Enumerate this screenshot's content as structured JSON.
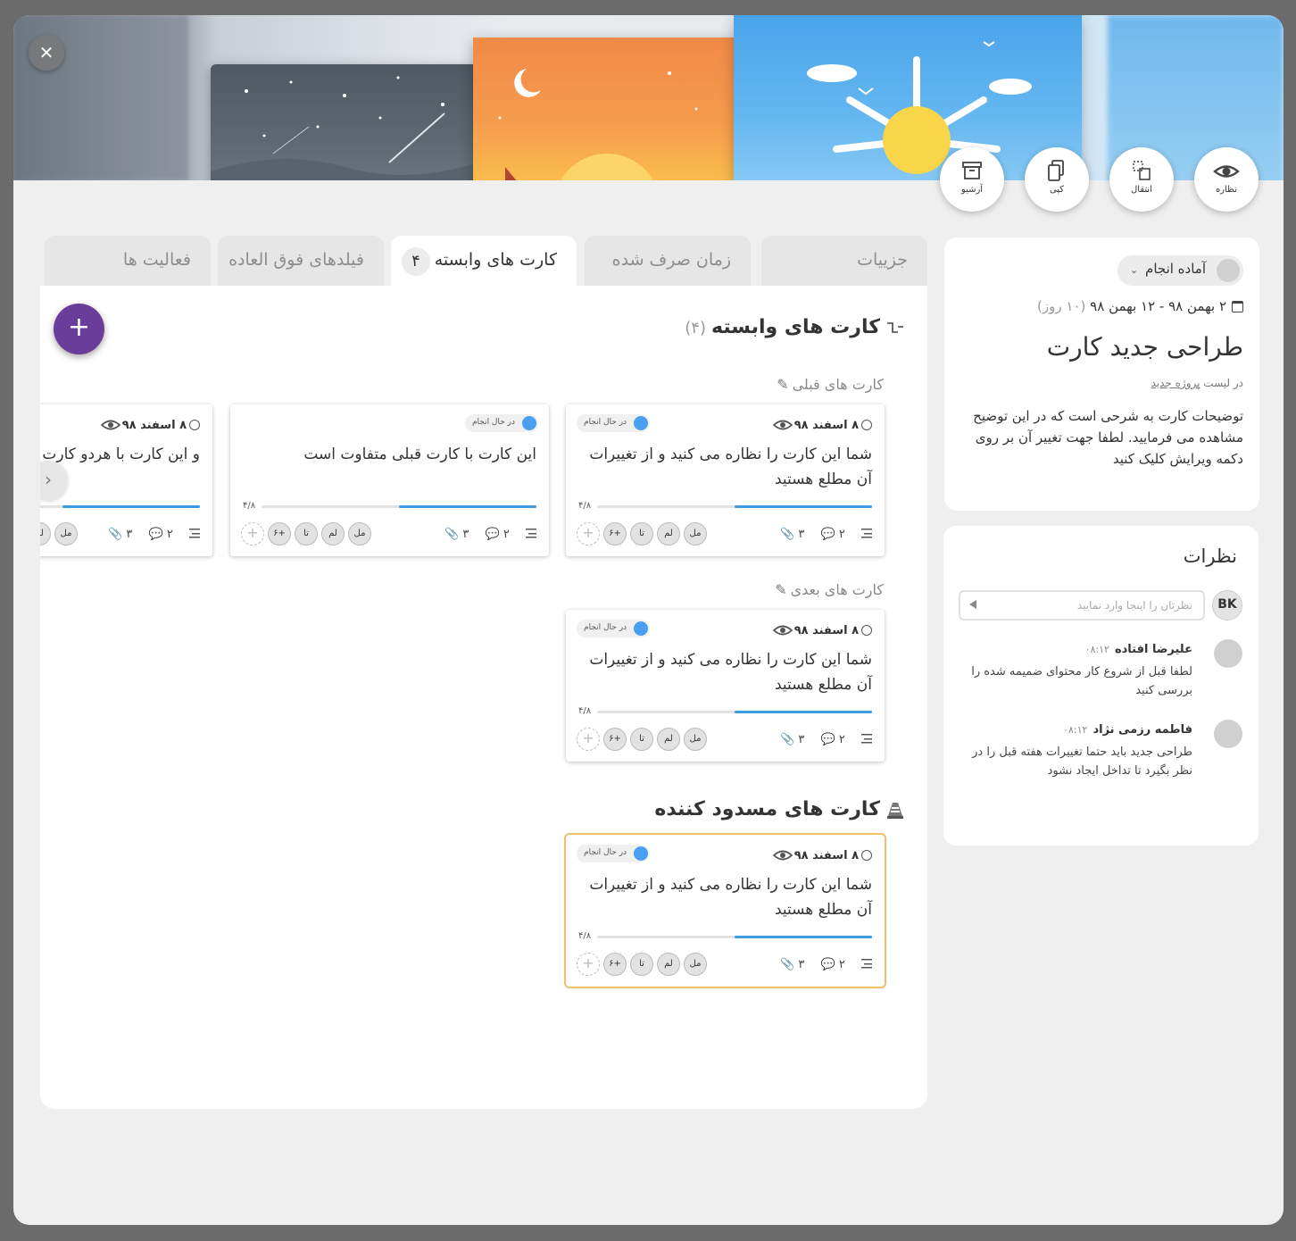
{
  "actions": {
    "watch": "نظاره",
    "move": "انتقال",
    "copy": "کپی",
    "archive": "آرشیو"
  },
  "tabs": [
    {
      "label": "جزییات"
    },
    {
      "label": "زمان صرف شده"
    },
    {
      "label": "کارت های وابسته",
      "count": "۴"
    },
    {
      "label": "فیلدهای فوق العاده"
    },
    {
      "label": "فعالیت ها"
    }
  ],
  "main": {
    "heading": "کارت های وابسته",
    "heading_count": "(۴)",
    "previous_label": "کارت های قبلی",
    "next_label": "کارت های بعدی",
    "blocking_heading": "کارت های مسدود کننده"
  },
  "cards": {
    "prev1": {
      "date": "۸ اسفند ۹۸",
      "status": "در حال انجام",
      "title": "شما این کارت را نظاره می کنید و از تغییرات آن مطلع هستید",
      "progress": "۴/۸",
      "progress_fraction": 0.5,
      "comments": "۲",
      "attachments": "۳",
      "members": [
        "مل",
        "لم",
        "تا",
        "۶+"
      ]
    },
    "prev2": {
      "status": "در حال انجام",
      "title": "این کارت با کارت قبلی متفاوت است",
      "progress": "۴/۸",
      "progress_fraction": 0.5,
      "comments": "۲",
      "attachments": "۳",
      "members": [
        "مل",
        "لم",
        "تا",
        "۶+"
      ]
    },
    "prev3": {
      "date": "۸ اسفند ۹۸",
      "title": "و این کارت با هردو کارت قبلی تف",
      "progress_fraction": 0.5,
      "comments": "۲",
      "attachments": "۳",
      "members": [
        "مل",
        "لم"
      ]
    },
    "next1": {
      "date": "۸ اسفند ۹۸",
      "status": "در حال انجام",
      "title": "شما این کارت را نظاره می کنید و از تغییرات آن مطلع هستید",
      "progress": "۴/۸",
      "progress_fraction": 0.5,
      "comments": "۲",
      "attachments": "۳",
      "members": [
        "مل",
        "لم",
        "تا",
        "۶+"
      ]
    },
    "block1": {
      "date": "۸ اسفند ۹۸",
      "status": "در حال انجام",
      "title": "شما این کارت را نظاره می کنید و از تغییرات آن مطلع هستید",
      "progress": "۴/۸",
      "progress_fraction": 0.5,
      "comments": "۲",
      "attachments": "۳",
      "members": [
        "مل",
        "لم",
        "تا",
        "۶+"
      ]
    }
  },
  "details": {
    "state": "آماده انجام",
    "date_range": "۲ بهمن ۹۸ - ۱۲ بهمن ۹۸",
    "duration": "(۱۰ روز)",
    "title": "طراحی جدید کارت",
    "in_list_prefix": "در لیست",
    "list_name": "پروژه جدید",
    "description": "توضیحات کارت به شرحی است که در این توضیح مشاهده می فرمایید. لطفا جهت تغییر آن بر روی دکمه ویرایش کلیک کنید"
  },
  "comments": {
    "title": "نظرات",
    "user_initials": "BK",
    "placeholder": "نظرتان را اینجا وارد نمایید",
    "items": [
      {
        "author": "علیرضا افتاده",
        "time": "۰۸:۱۲",
        "text": "لطفا قبل از شروع کار محتوای ضمیمه شده را بررسی کنید"
      },
      {
        "author": "فاطمه رزمی نژاد",
        "time": "۰۸:۱۲",
        "text": "طراحی جدید باید حتما تغییرات هفته قبل را در نظر بگیرد تا تداخل ایجاد نشود"
      }
    ]
  },
  "colors": {
    "accent": "#6a3d9a",
    "progress": "#3d9be0",
    "status_dot": "#4a9ff0",
    "blocking_border": "#f2c06a"
  }
}
